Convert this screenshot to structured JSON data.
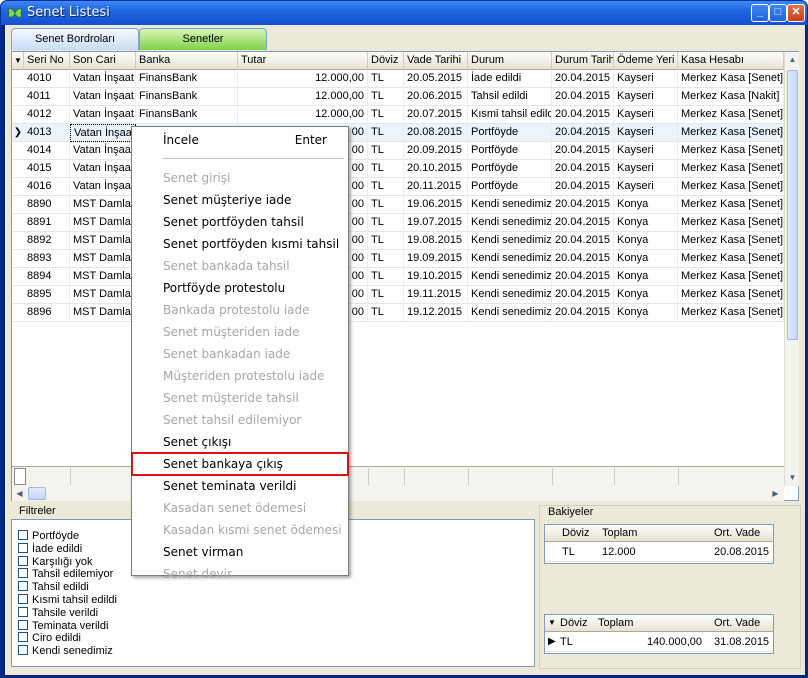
{
  "window": {
    "title": "Senet Listesi",
    "min": "_",
    "max": "□",
    "close": "✕"
  },
  "tabs": [
    {
      "label": "Senet Bordroları"
    },
    {
      "label": "Senetler"
    }
  ],
  "grid": {
    "columns": [
      "Seri No",
      "Son Cari",
      "Banka",
      "Tutar",
      "Döviz",
      "Vade Tarihi",
      "Durum",
      "Durum Tarih",
      "Ödeme Yeri",
      "Kasa Hesabı"
    ],
    "rows": [
      [
        "4010",
        "Vatan İnşaat Müdendislik Mimarlık",
        "FinansBank",
        "12.000,00",
        "TL",
        "20.05.2015",
        "İade edildi",
        "20.04.2015",
        "Kayseri",
        "Merkez Kasa [Senet]"
      ],
      [
        "4011",
        "Vatan İnşaat Müdendislik Mimarlık",
        "FinansBank",
        "12.000,00",
        "TL",
        "20.06.2015",
        "Tahsil edildi",
        "20.04.2015",
        "Kayseri",
        "Merkez Kasa [Nakit] [Senet]"
      ],
      [
        "4012",
        "Vatan İnşaat Müdendislik Mimarlık",
        "FinansBank",
        "12.000,00",
        "TL",
        "20.07.2015",
        "Kısmi tahsil edildi",
        "20.04.2015",
        "Kayseri",
        "Merkez Kasa [Senet]"
      ],
      [
        "4013",
        "Vatan İnşaat",
        "",
        "00",
        "TL",
        "20.08.2015",
        "Portföyde",
        "20.04.2015",
        "Kayseri",
        "Merkez Kasa [Senet]"
      ],
      [
        "4014",
        "Vatan İnşaat",
        "",
        "00",
        "TL",
        "20.09.2015",
        "Portföyde",
        "20.04.2015",
        "Kayseri",
        "Merkez Kasa [Senet]"
      ],
      [
        "4015",
        "Vatan İnşaat",
        "",
        "00",
        "TL",
        "20.10.2015",
        "Portföyde",
        "20.04.2015",
        "Kayseri",
        "Merkez Kasa [Senet]"
      ],
      [
        "4016",
        "Vatan İnşaat",
        "",
        "00",
        "TL",
        "20.11.2015",
        "Portföyde",
        "20.04.2015",
        "Kayseri",
        "Merkez Kasa [Senet]"
      ],
      [
        "8890",
        "MST Damlam",
        "",
        "00",
        "TL",
        "19.06.2015",
        "Kendi senedimiz",
        "20.04.2015",
        "Konya",
        "Merkez Kasa [Senet]"
      ],
      [
        "8891",
        "MST Damlam",
        "",
        "00",
        "TL",
        "19.07.2015",
        "Kendi senedimiz",
        "20.04.2015",
        "Konya",
        "Merkez Kasa [Senet]"
      ],
      [
        "8892",
        "MST Damlam",
        "",
        "00",
        "TL",
        "19.08.2015",
        "Kendi senedimiz",
        "20.04.2015",
        "Konya",
        "Merkez Kasa [Senet]"
      ],
      [
        "8893",
        "MST Damlam",
        "",
        "00",
        "TL",
        "19.09.2015",
        "Kendi senedimiz",
        "20.04.2015",
        "Konya",
        "Merkez Kasa [Senet]"
      ],
      [
        "8894",
        "MST Damlam",
        "",
        "00",
        "TL",
        "19.10.2015",
        "Kendi senedimiz",
        "20.04.2015",
        "Konya",
        "Merkez Kasa [Senet]"
      ],
      [
        "8895",
        "MST Damlam",
        "",
        "00",
        "TL",
        "19.11.2015",
        "Kendi senedimiz",
        "20.04.2015",
        "Konya",
        "Merkez Kasa [Senet]"
      ],
      [
        "8896",
        "MST Damlam",
        "",
        "00",
        "TL",
        "19.12.2015",
        "Kendi senedimiz",
        "20.04.2015",
        "Konya",
        "Merkez Kasa [Senet]"
      ]
    ],
    "selected_row": 3
  },
  "context_menu": {
    "items": [
      {
        "label": "İncele",
        "accel": "Enter",
        "enabled": true
      },
      {
        "separator": true
      },
      {
        "label": "Senet girişi",
        "enabled": false
      },
      {
        "label": "Senet müşteriye iade",
        "enabled": true
      },
      {
        "label": "Senet portföyden tahsil",
        "enabled": true
      },
      {
        "label": "Senet portföyden kısmi tahsil",
        "enabled": true
      },
      {
        "label": "Senet bankada tahsil",
        "enabled": false
      },
      {
        "label": "Portföyde protestolu",
        "enabled": true
      },
      {
        "label": "Bankada protestolu iade",
        "enabled": false
      },
      {
        "label": "Senet müşteriden iade",
        "enabled": false
      },
      {
        "label": "Senet bankadan iade",
        "enabled": false
      },
      {
        "label": "Müşteriden protestolu iade",
        "enabled": false
      },
      {
        "label": "Senet müşteride tahsil",
        "enabled": false
      },
      {
        "label": "Senet tahsil edilemiyor",
        "enabled": false
      },
      {
        "label": "Senet çıkışı",
        "enabled": true
      },
      {
        "label": "Senet bankaya çıkış",
        "enabled": true,
        "highlighted": true
      },
      {
        "label": "Senet teminata verildi",
        "enabled": true
      },
      {
        "label": "Kasadan senet ödemesi",
        "enabled": false
      },
      {
        "label": "Kasadan kısmi senet ödemesi",
        "enabled": false
      },
      {
        "label": "Senet virman",
        "enabled": true
      },
      {
        "label": "Senet devir",
        "enabled": false
      }
    ]
  },
  "filters": {
    "title": "Filtreler",
    "items": [
      "Portföyde",
      "İade edildi",
      "Karşılığı yok",
      "Tahsil edilemiyor",
      "Tahsil edildi",
      "Kısmi tahsil edildi",
      "Tahsile verildi",
      "Teminata verildi",
      "Ciro edildi",
      "Kendi senedimiz"
    ]
  },
  "balances": {
    "title": "Bakiyeler",
    "top": {
      "headers": [
        "Döviz",
        "Toplam",
        "Ort. Vade"
      ],
      "row": [
        "TL",
        "12.000",
        "20.08.2015"
      ]
    },
    "bottom": {
      "headers": [
        "Döviz",
        "Toplam",
        "Ort. Vade"
      ],
      "row": [
        "TL",
        "140.000,00",
        "31.08.2015"
      ]
    }
  },
  "colors": {
    "highlight_border": "#e01010",
    "active_tab": "#7fd04a",
    "title_bar": "#2166e0"
  }
}
